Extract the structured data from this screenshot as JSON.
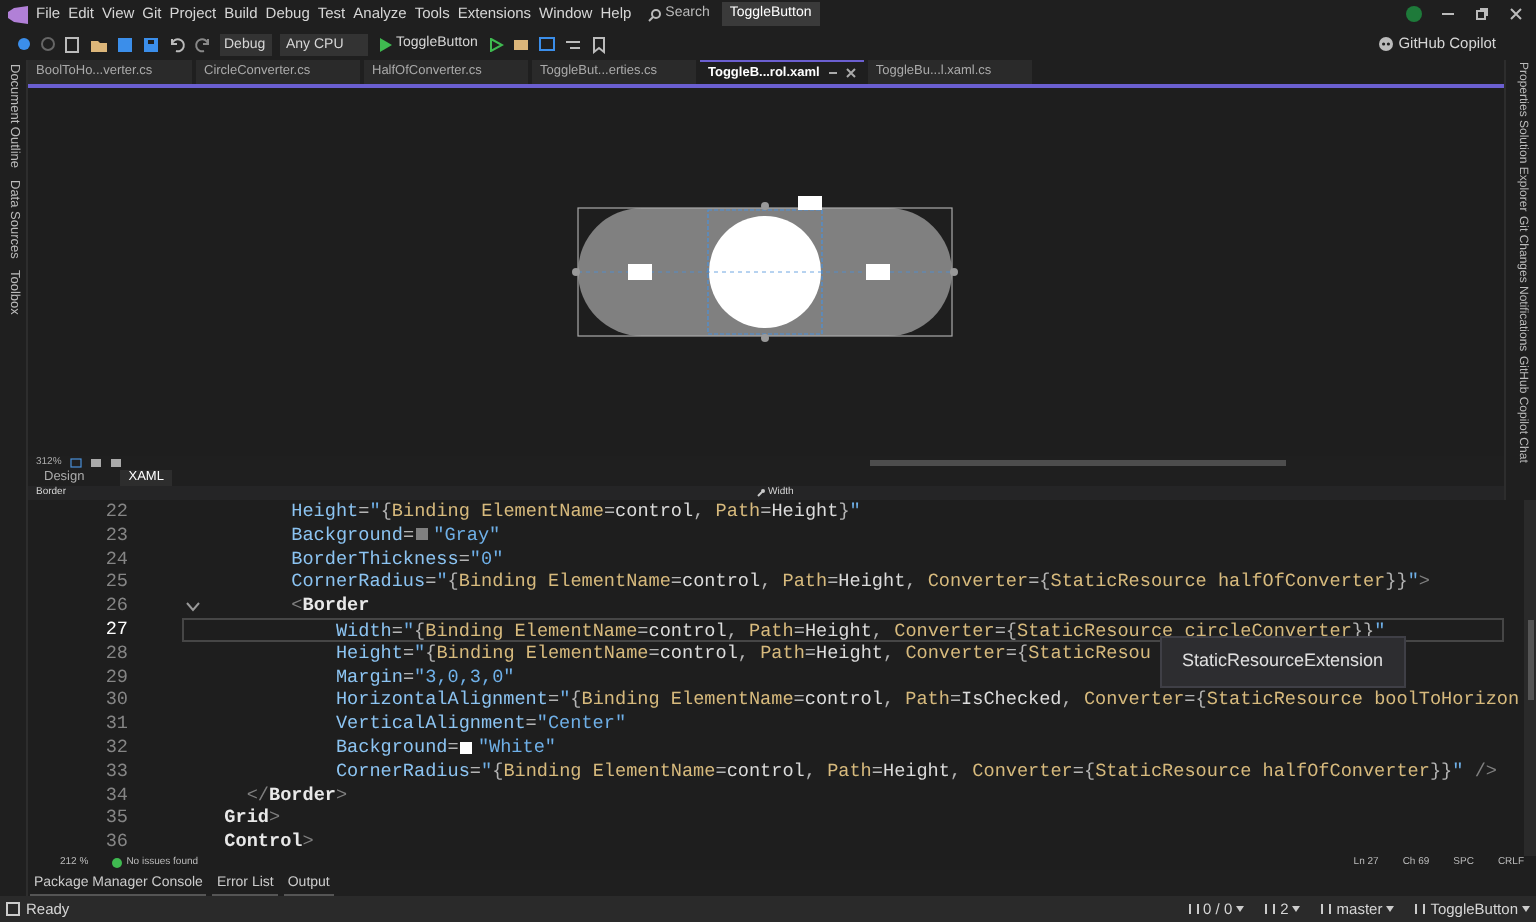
{
  "menu": [
    "File",
    "Edit",
    "View",
    "Git",
    "Project",
    "Build",
    "Debug",
    "Test",
    "Analyze",
    "Tools",
    "Extensions",
    "Window",
    "Help"
  ],
  "search": {
    "label": "Search"
  },
  "solution_badge": "ToggleButton",
  "toolbar": {
    "configuration": "Debug",
    "platform": "Any CPU",
    "start_target": "ToggleButton",
    "copilot": "GitHub Copilot"
  },
  "left_tool_tabs": [
    "Document Outline",
    "Data Sources",
    "Toolbox"
  ],
  "right_tool_tabs": [
    "Properties",
    "Solution Explorer",
    "Git Changes",
    "Notifications",
    "GitHub Copilot Chat"
  ],
  "document_tabs": [
    {
      "label": "BoolToHo...verter.cs",
      "selected": false
    },
    {
      "label": "CircleConverter.cs",
      "selected": false
    },
    {
      "label": "HalfOfConverter.cs",
      "selected": false
    },
    {
      "label": "ToggleBut...erties.cs",
      "selected": false
    },
    {
      "label": "ToggleB...rol.xaml",
      "selected": true
    },
    {
      "label": "ToggleBu...l.xaml.cs",
      "selected": false
    }
  ],
  "designer": {
    "zoom": "312%",
    "view_tabs": [
      {
        "label": "Design",
        "selected": false
      },
      {
        "label": "XAML",
        "selected": true
      }
    ]
  },
  "breadcrumb": {
    "element": "Border",
    "member": "Width"
  },
  "code": {
    "lines": [
      {
        "number": "22",
        "text": "        Height=\"{Binding ElementName=control, Path=Height}\"",
        "current": false,
        "fold": false
      },
      {
        "number": "23",
        "text": "        Background= \"Gray\"",
        "color": "#808080",
        "current": false,
        "fold": false
      },
      {
        "number": "24",
        "text": "        BorderThickness=\"0\"",
        "current": false,
        "fold": false
      },
      {
        "number": "25",
        "text": "        CornerRadius=\"{Binding ElementName=control, Path=Height, Converter={StaticResource halfOfConverter}}\">",
        "current": false,
        "fold": false
      },
      {
        "number": "26",
        "text": "        <Border",
        "current": false,
        "fold": true
      },
      {
        "number": "27",
        "text": "            Width=\"{Binding ElementName=control, Path=Height, Converter={StaticResource circleConverter}}\"",
        "current": true,
        "fold": false
      },
      {
        "number": "28",
        "text": "            Height=\"{Binding ElementName=control, Path=Height, Converter={StaticResou",
        "current": false,
        "fold": false
      },
      {
        "number": "29",
        "text": "            Margin=\"3,0,3,0\"",
        "current": false,
        "fold": false
      },
      {
        "number": "30",
        "text": "            HorizontalAlignment=\"{Binding ElementName=control, Path=IsChecked, Converter={StaticResource boolToHorizon",
        "current": false,
        "fold": false
      },
      {
        "number": "31",
        "text": "            VerticalAlignment=\"Center\"",
        "current": false,
        "fold": false
      },
      {
        "number": "32",
        "text": "            Background= \"White\"",
        "color": "#ffffff",
        "current": false,
        "fold": false
      },
      {
        "number": "33",
        "text": "            CornerRadius=\"{Binding ElementName=control, Path=Height, Converter={StaticResource halfOfConverter}}\" />",
        "current": false,
        "fold": false
      },
      {
        "number": "34",
        "text": "    </Border>",
        "current": false,
        "fold": false
      },
      {
        "number": "35",
        "text": "  Grid>",
        "current": false,
        "fold": false
      },
      {
        "number": "36",
        "text": "  Control>",
        "current": false,
        "fold": false
      }
    ],
    "tooltip": "StaticResourceExtension"
  },
  "editor_status": {
    "zoom": "212 %",
    "issues": "No issues found",
    "line": "Ln 27",
    "column": "Ch 69",
    "whitespace": "SPC",
    "line_ending": "CRLF"
  },
  "bottom_tabs": [
    "Package Manager Console",
    "Error List",
    "Output"
  ],
  "status_bar": {
    "state": "Ready",
    "changes": "0 / 0",
    "edits": "2",
    "branch": "master",
    "repository": "ToggleButton"
  }
}
